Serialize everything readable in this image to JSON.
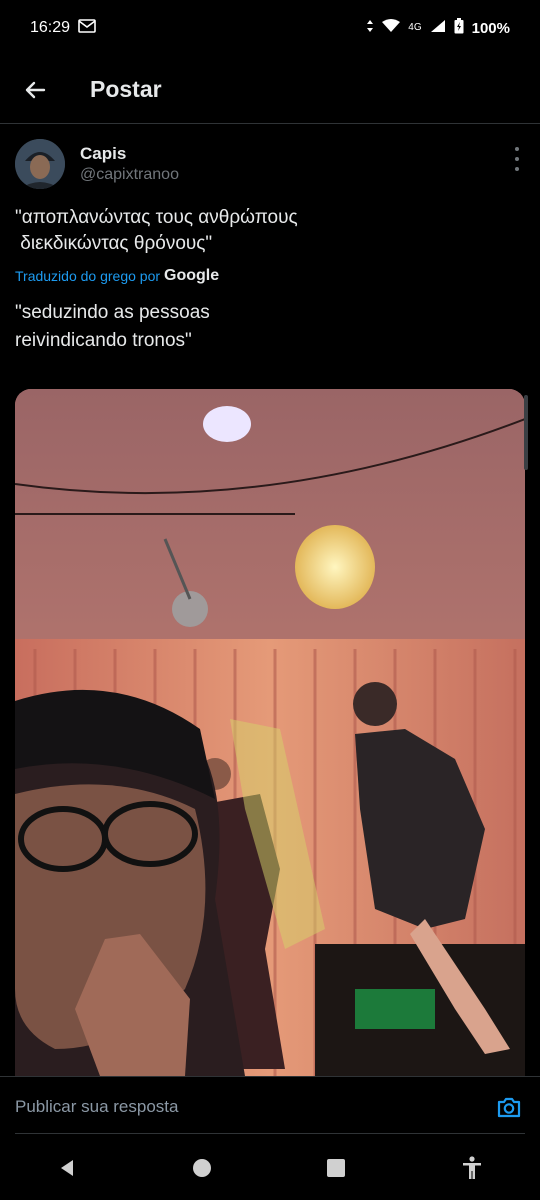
{
  "status": {
    "time": "16:29",
    "network": "4G",
    "battery": "100%"
  },
  "header": {
    "title": "Postar"
  },
  "post": {
    "display_name": "Capis",
    "handle": "@capixtranoo",
    "greek_text": "\"αποπλανώντας τους ανθρώπους\n διεκδικώντας θρόνους\"",
    "translated_label": "Traduzido do grego por",
    "translator": "Google",
    "translation": "\"seduzindo as pessoas\nreivindicando tronos\""
  },
  "reply": {
    "placeholder": "Publicar sua resposta"
  },
  "colors": {
    "accent": "#1d9bf0",
    "background": "#000000",
    "muted": "#71767b"
  },
  "icons": [
    "gmail-icon",
    "signal-icon",
    "wifi-icon",
    "battery-icon",
    "back-arrow-icon",
    "more-icon",
    "camera-icon",
    "nav-back-icon",
    "nav-home-icon",
    "nav-recents-icon",
    "accessibility-icon"
  ]
}
